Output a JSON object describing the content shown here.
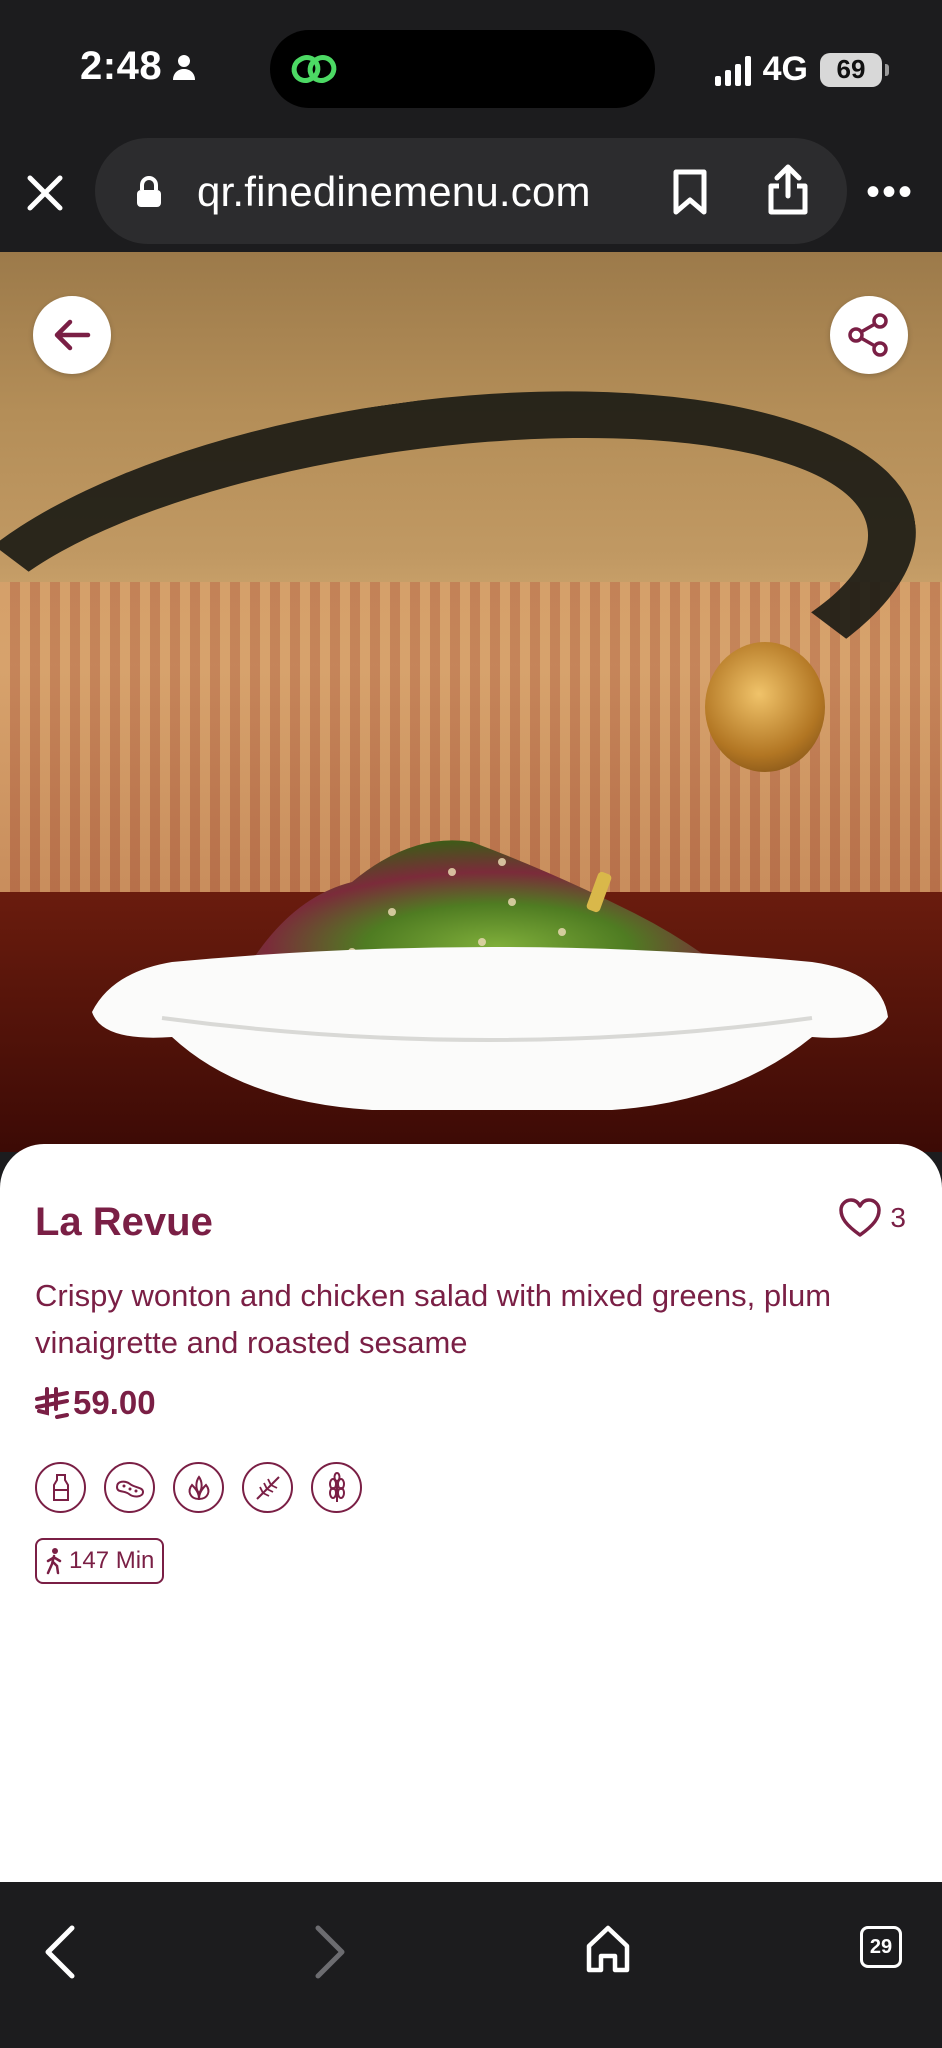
{
  "status_bar": {
    "time": "2:48",
    "network": "4G",
    "battery": "69"
  },
  "browser": {
    "url": "qr.finedinemenu.com"
  },
  "item": {
    "title": "La Revue",
    "likes": "3",
    "description": "Crispy wonton and chicken salad with mixed greens, plum vinaigrette and roasted sesame",
    "currency_symbol": "⃁",
    "price": "59.00",
    "allergen_icons": [
      "milk-bottle-icon",
      "peanut-icon",
      "leaves-icon",
      "wheat-icon",
      "grain-icon"
    ],
    "prep_time": "147 Min"
  },
  "bottom_nav": {
    "tabs_count": "29"
  },
  "colors": {
    "accent": "#7a1f45",
    "chrome": "#1c1c1e",
    "url_pill": "#2c2c2e"
  }
}
